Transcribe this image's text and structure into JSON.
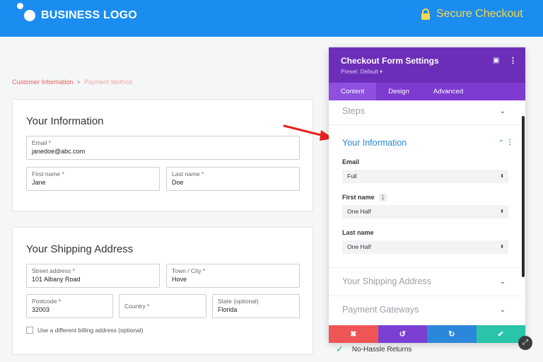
{
  "header": {
    "logo_text": "BUSINESS LOGO",
    "secure_text": "Secure Checkout",
    "brand_color": "#1b8df0",
    "secure_color": "#f8d64c"
  },
  "breadcrumb": {
    "current": "Customer Information",
    "separator": ">",
    "next": "Payment Method"
  },
  "info_card": {
    "title": "Your Information",
    "email": {
      "label": "Email *",
      "value": "janedoe@abc.com"
    },
    "first_name": {
      "label": "First name *",
      "value": "Jane"
    },
    "last_name": {
      "label": "Last name *",
      "value": "Doe"
    }
  },
  "shipping_card": {
    "title": "Your Shipping Address",
    "street": {
      "label": "Street address *",
      "value": "101 Albany Road"
    },
    "town": {
      "label": "Town / City *",
      "value": "Hove"
    },
    "postcode": {
      "label": "Postcode *",
      "value": "32003"
    },
    "country": {
      "label": "Country *",
      "value": ""
    },
    "state": {
      "label": "State (optional)",
      "value": "Florida"
    },
    "billing_checkbox_label": "Use a different billing address (optional)"
  },
  "panel": {
    "title": "Checkout Form Settings",
    "preset": "Preset: Default ▾",
    "tabs": [
      "Content",
      "Design",
      "Advanced"
    ],
    "active_tab": "Content",
    "sections": {
      "steps": "Steps",
      "your_information": "Your Information",
      "shipping": "Your Shipping Address",
      "payment": "Payment Gateways"
    },
    "options": [
      {
        "label": "Email",
        "value": "Full"
      },
      {
        "label": "First name",
        "value": "One Half"
      },
      {
        "label": "Last name",
        "value": "One Half"
      }
    ],
    "header_color": "#6c2eb9",
    "actions": {
      "close": "✖",
      "undo": "↺",
      "redo": "↻",
      "save": "✔"
    }
  },
  "footer": {
    "returns_text": "No-Hassle Returns"
  }
}
